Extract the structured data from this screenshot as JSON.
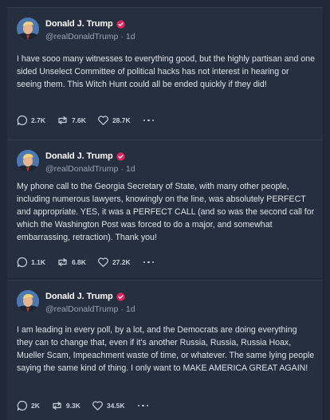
{
  "posts": [
    {
      "author": "Donald J. Trump",
      "handle": "@realDonaldTrump",
      "separator": "·",
      "time": "1d",
      "text": "I have sooo many witnesses to everything good, but the highly partisan and one sided Unselect Committee of political hacks has not interest in hearing or seeing them. This Witch Hunt could all be ended quickly if they did!",
      "replies": "2.7K",
      "reposts": "7.6K",
      "likes": "28.7K"
    },
    {
      "author": "Donald J. Trump",
      "handle": "@realDonaldTrump",
      "separator": "·",
      "time": "1d",
      "text": "My phone call to the Georgia Secretary of State, with many other people, including numerous lawyers, knowingly on the line, was absolutely PERFECT and appropriate. YES, it was a PERFECT CALL (and so was the second call for which the Washington Post was forced to do a major, and somewhat embarrassing, retraction). Thank you!",
      "replies": "1.1K",
      "reposts": "6.8K",
      "likes": "27.2K"
    },
    {
      "author": "Donald J. Trump",
      "handle": "@realDonaldTrump",
      "separator": "·",
      "time": "1d",
      "text": "I am leading in every poll, by a lot, and the Democrats are doing everything they can to change that, even if it's another Russia, Russia, Russia Hoax, Mueller Scam, Impeachment waste of time, or whatever. The same lying people saying the same kind of thing. I only want to MAKE AMERICA GREAT AGAIN!",
      "replies": "2K",
      "reposts": "9.3K",
      "likes": "34.5K"
    }
  ],
  "colors": {
    "background": "#202838",
    "card": "#262f3f",
    "verified_badge": "#e0245e",
    "muted_text": "#9aa3b2"
  },
  "icons": [
    "avatar",
    "verified-badge-icon",
    "reply-icon",
    "repost-icon",
    "like-icon",
    "more-options-icon"
  ]
}
